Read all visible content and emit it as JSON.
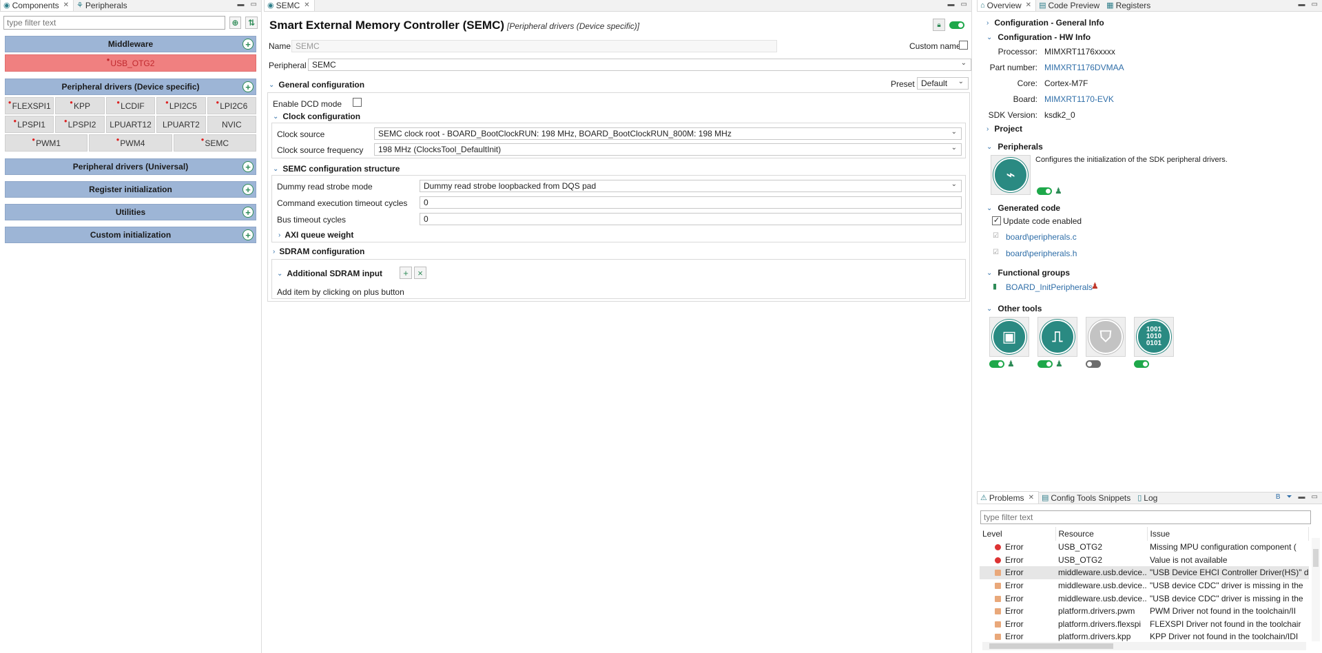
{
  "left_tabs": [
    {
      "label": "Components",
      "closable": true,
      "active": true
    },
    {
      "label": "Peripherals",
      "closable": false,
      "active": false
    }
  ],
  "left_filter_placeholder": "type filter text",
  "categories": {
    "middleware": "Middleware",
    "periph_device": "Peripheral drivers (Device specific)",
    "periph_universal": "Peripheral drivers (Universal)",
    "register_init": "Register initialization",
    "utilities": "Utilities",
    "custom_init": "Custom initialization"
  },
  "middleware_items": [
    "USB_OTG2"
  ],
  "device_rows": [
    [
      "FLEXSPI1",
      "KPP",
      "LCDIF",
      "LPI2C5",
      "LPI2C6"
    ],
    [
      "LPSPI1",
      "LPSPI2",
      "LPUART12",
      "LPUART2",
      "NVIC"
    ],
    [
      "PWM1",
      "PWM4",
      "SEMC"
    ]
  ],
  "device_error_flags": [
    [
      true,
      true,
      true,
      true,
      true
    ],
    [
      true,
      true,
      false,
      false,
      false
    ],
    [
      true,
      true,
      true
    ]
  ],
  "center_tab": "SEMC",
  "semc": {
    "title": "Smart External Memory Controller (SEMC)",
    "subtitle": "[Peripheral drivers (Device specific)]",
    "name_label": "Name",
    "name_value": "SEMC",
    "custom_name_label": "Custom name",
    "peripheral_label": "Peripheral",
    "peripheral_value": "SEMC",
    "general_config": "General configuration",
    "preset_label": "Preset",
    "preset_value": "Default",
    "enable_dcd_label": "Enable DCD mode",
    "clock_config": "Clock configuration",
    "clock_source_label": "Clock source",
    "clock_source_value": "SEMC clock root - BOARD_BootClockRUN: 198 MHz, BOARD_BootClockRUN_800M: 198 MHz",
    "clock_freq_label": "Clock source frequency",
    "clock_freq_value": "198 MHz (ClocksTool_DefaultInit)",
    "semc_struct": "SEMC configuration structure",
    "dummy_label": "Dummy read strobe mode",
    "dummy_value": "Dummy read strobe loopbacked from DQS pad",
    "cmd_timeout_label": "Command execution timeout cycles",
    "cmd_timeout_value": "0",
    "bus_timeout_label": "Bus timeout cycles",
    "bus_timeout_value": "0",
    "axi_queue": "AXI queue weight",
    "sdram_config": "SDRAM configuration",
    "additional_sdram": "Additional SDRAM input",
    "add_hint": "Add item by clicking on plus button"
  },
  "right_tabs": [
    {
      "label": "Overview",
      "closable": true,
      "active": true
    },
    {
      "label": "Code Preview",
      "closable": false,
      "active": false
    },
    {
      "label": "Registers",
      "closable": false,
      "active": false
    }
  ],
  "overview": {
    "general_info": "Configuration - General Info",
    "hw_info": "Configuration - HW Info",
    "hw": [
      {
        "key": "Processor:",
        "value": "MIMXRT1176xxxxx",
        "link": false
      },
      {
        "key": "Part number:",
        "value": "MIMXRT1176DVMAA",
        "link": true
      },
      {
        "key": "Core:",
        "value": "Cortex-M7F",
        "link": false
      },
      {
        "key": "Board:",
        "value": "MIMXRT1170-EVK",
        "link": true
      },
      {
        "key": "SDK Version:",
        "value": "ksdk2_0",
        "link": false
      }
    ],
    "project": "Project",
    "peripherals": "Peripherals",
    "peripherals_desc": "Configures the initialization of the SDK peripheral drivers.",
    "generated_code": "Generated code",
    "update_code": "Update code enabled",
    "files": [
      "board\\peripherals.c",
      "board\\peripherals.h"
    ],
    "functional_groups": "Functional groups",
    "group": "BOARD_InitPeripherals",
    "other_tools": "Other tools",
    "other_tool_icons": [
      "chip-icon",
      "pulse-wave-icon",
      "shield-icon",
      "binary-data-icon"
    ]
  },
  "bottom_tabs": [
    {
      "label": "Problems",
      "closable": true,
      "active": true
    },
    {
      "label": "Config Tools Snippets",
      "closable": false,
      "active": false
    },
    {
      "label": "Log",
      "closable": false,
      "active": false
    }
  ],
  "problems_filter_placeholder": "type filter text",
  "problems_columns": [
    "Level",
    "Resource",
    "Issue"
  ],
  "problems": [
    {
      "level": "Error",
      "kind": "error",
      "resource": "USB_OTG2",
      "issue": "Missing MPU configuration component (",
      "selected": false
    },
    {
      "level": "Error",
      "kind": "error",
      "resource": "USB_OTG2",
      "issue": "Value is not available",
      "selected": false
    },
    {
      "level": "Error",
      "kind": "doc",
      "resource": "middleware.usb.device...",
      "issue": "\"USB Device EHCI Controller Driver(HS)\" d",
      "selected": true
    },
    {
      "level": "Error",
      "kind": "doc",
      "resource": "middleware.usb.device...",
      "issue": "\"USB device CDC\" driver is missing in the",
      "selected": false
    },
    {
      "level": "Error",
      "kind": "doc",
      "resource": "middleware.usb.device...",
      "issue": "\"USB device CDC\" driver is missing in the",
      "selected": false
    },
    {
      "level": "Error",
      "kind": "doc",
      "resource": "platform.drivers.pwm",
      "issue": "PWM Driver not found in the toolchain/II",
      "selected": false
    },
    {
      "level": "Error",
      "kind": "doc",
      "resource": "platform.drivers.flexspi",
      "issue": "FLEXSPI Driver not found in the toolchair",
      "selected": false
    },
    {
      "level": "Error",
      "kind": "doc",
      "resource": "platform.drivers.kpp",
      "issue": "KPP Driver not found in the toolchain/IDI",
      "selected": false
    }
  ]
}
